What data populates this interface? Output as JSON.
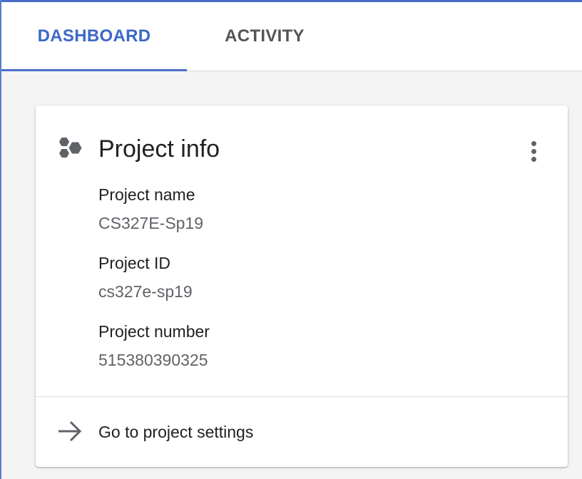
{
  "tabs": [
    {
      "label": "DASHBOARD",
      "active": true
    },
    {
      "label": "ACTIVITY",
      "active": false
    }
  ],
  "colors": {
    "accent": "#4a6fc9",
    "active_tab_text": "#3c68c8",
    "inactive_tab_text": "#545454",
    "secondary_text": "#5f6368"
  },
  "project_info": {
    "title": "Project info",
    "icon": "hexagons-icon",
    "menu_icon": "more-vert-icon",
    "fields": [
      {
        "label": "Project name",
        "value": "CS327E-Sp19"
      },
      {
        "label": "Project ID",
        "value": "cs327e-sp19"
      },
      {
        "label": "Project number",
        "value": "515380390325"
      }
    ],
    "settings_link": {
      "icon": "arrow-right-icon",
      "label": "Go to project settings"
    }
  }
}
